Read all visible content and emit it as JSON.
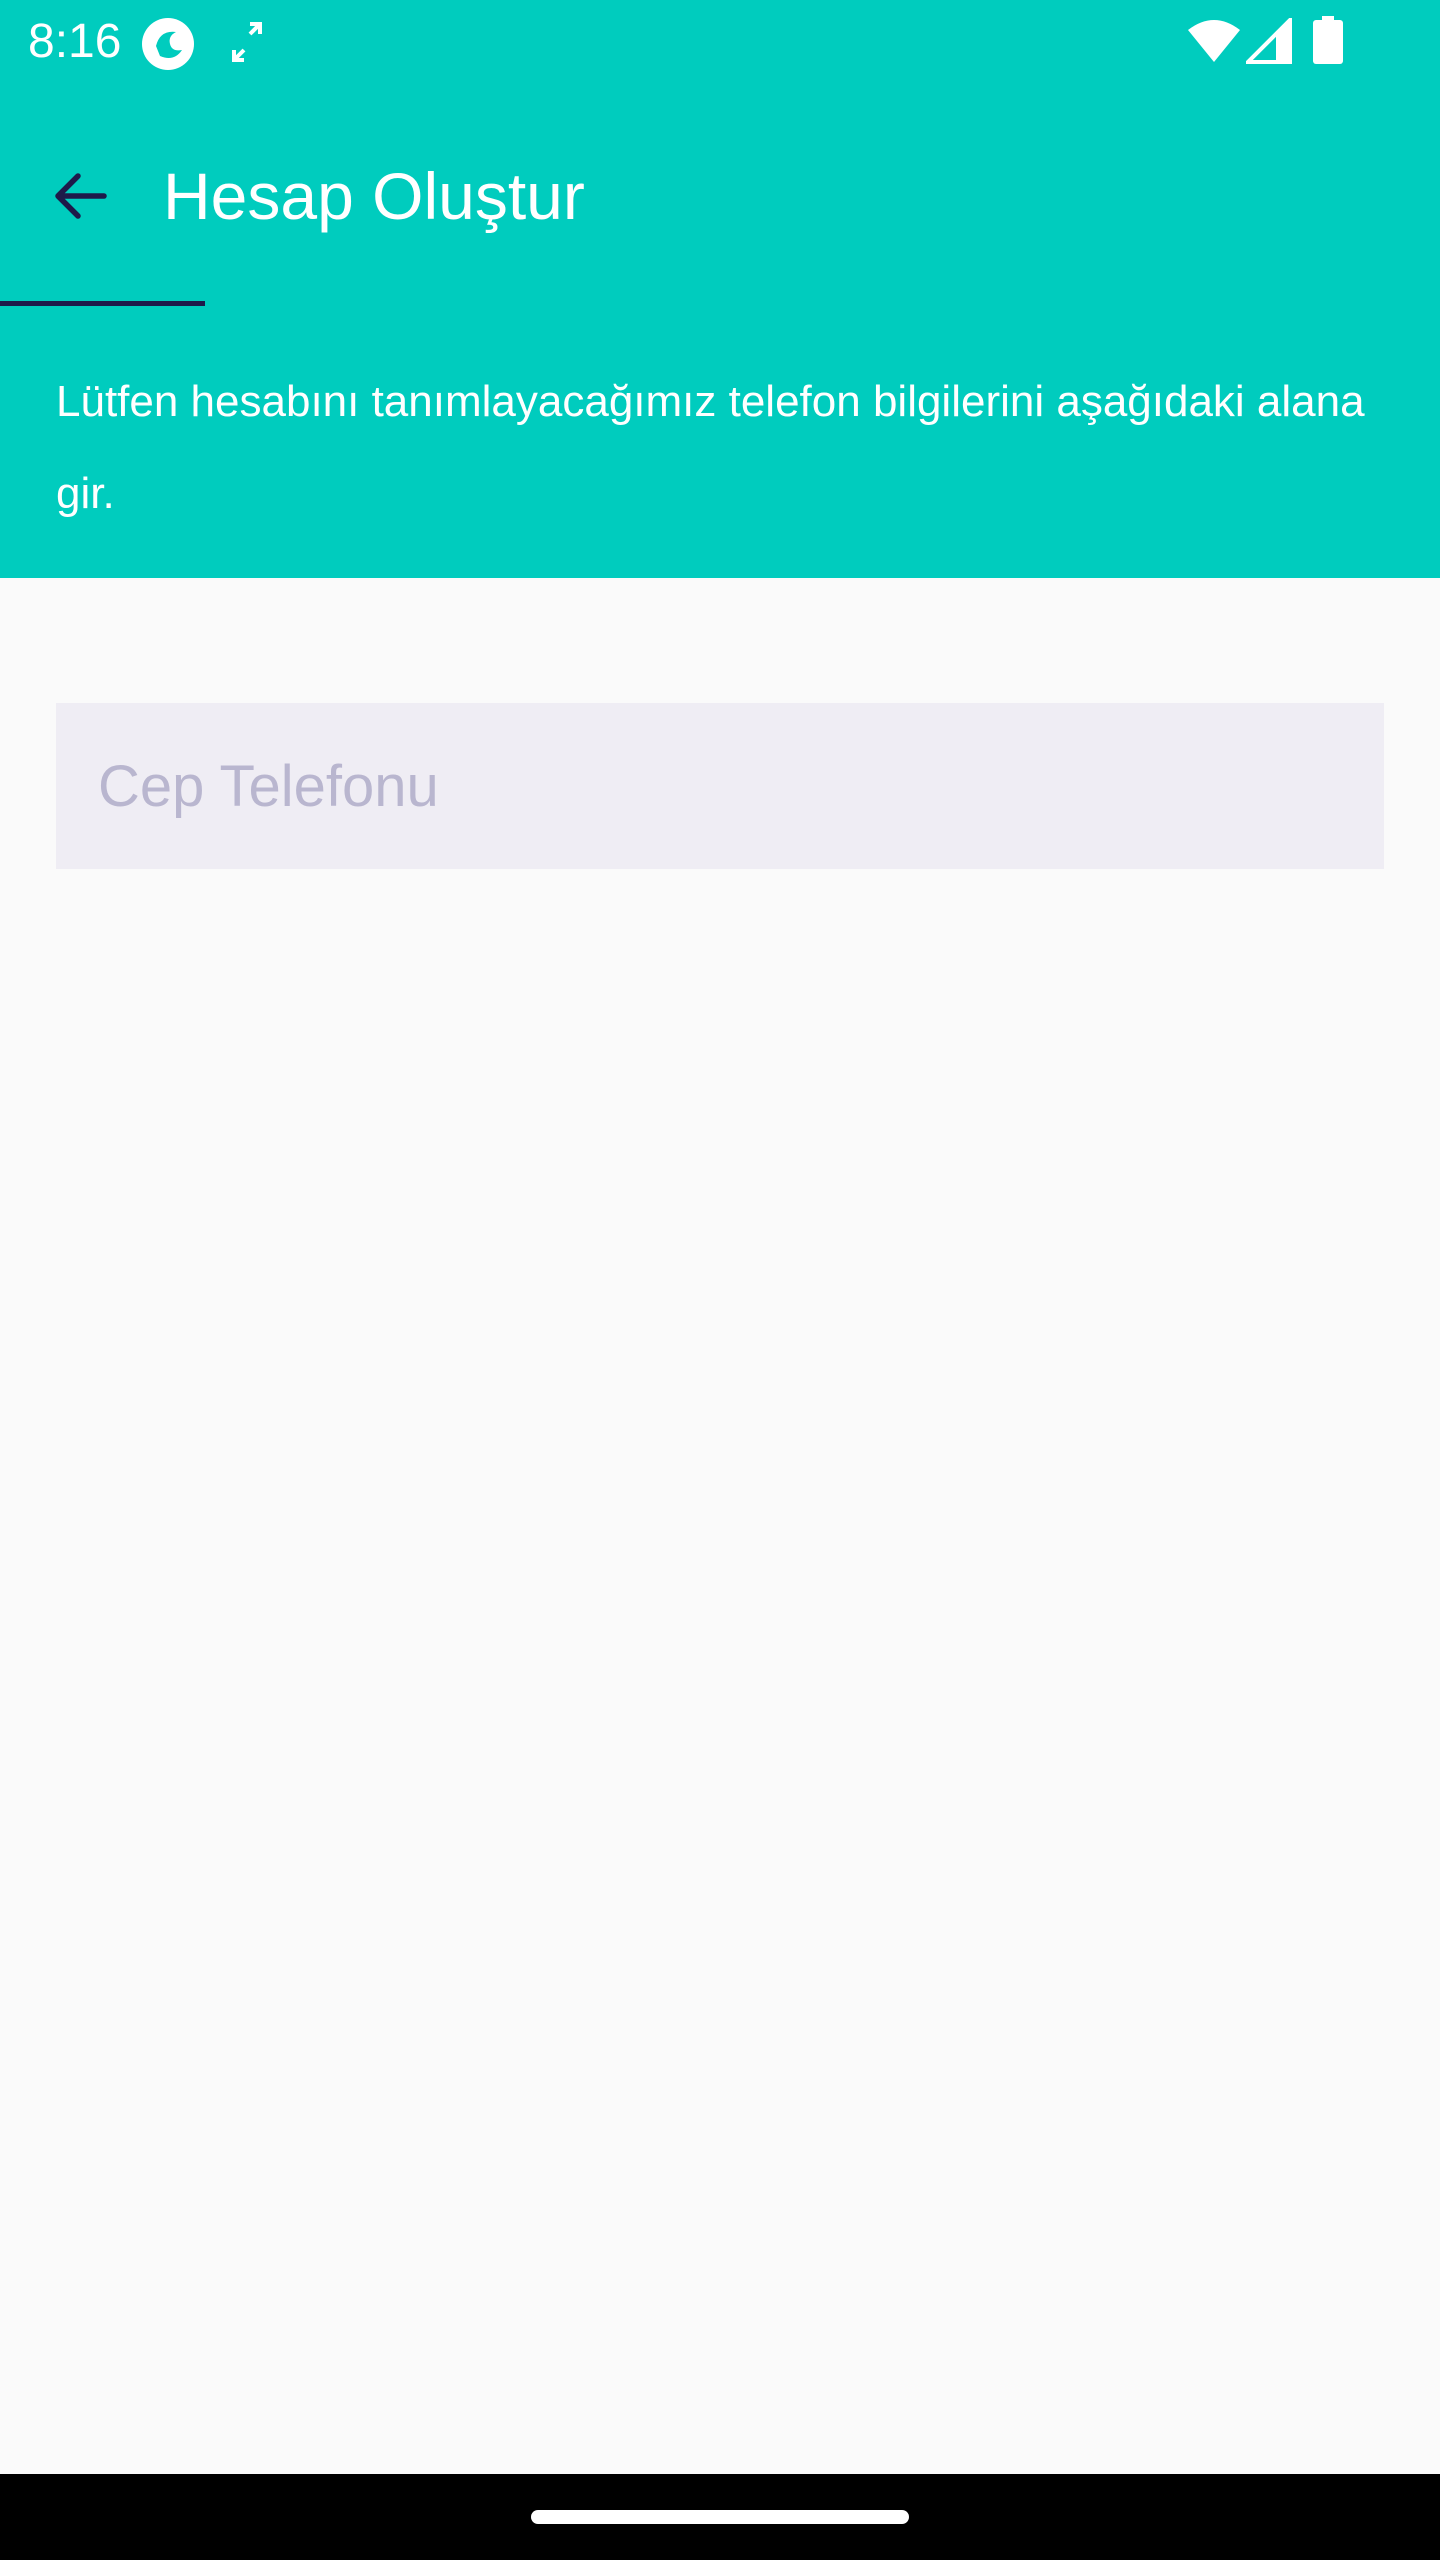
{
  "colors": {
    "primary": "#00ccbe",
    "accent_dark": "#1e1a4a",
    "background": "#fafafa",
    "input_background": "#efedf4",
    "placeholder": "#b9b6cf"
  },
  "status_bar": {
    "time": "8:16",
    "icons": [
      "app-notification-icon",
      "expand-icon",
      "wifi-icon",
      "cell-signal-icon",
      "battery-icon"
    ]
  },
  "app_bar": {
    "back_icon": "arrow-left-icon",
    "title": "Hesap Oluştur"
  },
  "description": {
    "text": "Lütfen hesabını tanımlayacağımız telefon bilgilerini aşağıdaki alana gir."
  },
  "form": {
    "phone": {
      "value": "",
      "placeholder": "Cep Telefonu"
    }
  }
}
